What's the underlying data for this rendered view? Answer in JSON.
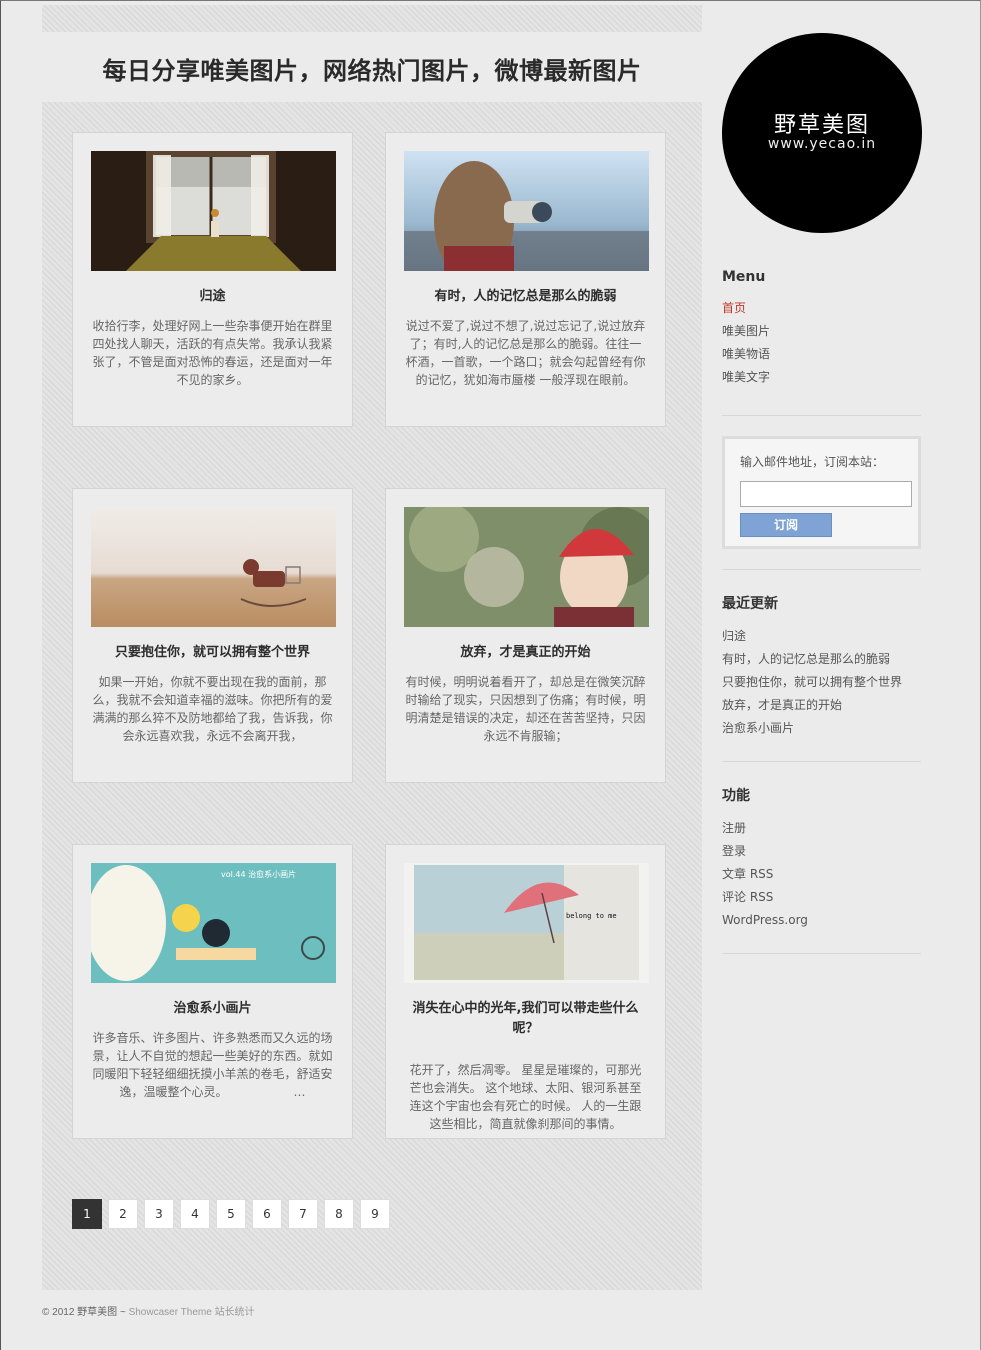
{
  "header": {
    "site_title": "每日分享唯美图片，网络热门图片，微博最新图片"
  },
  "logo": {
    "name": "野草美图",
    "url": "www.yecao.in"
  },
  "posts": [
    {
      "title": "归途",
      "excerpt": "收拾行李，处理好网上一些杂事便开始在群里四处找人聊天，活跃的有点失常。我承认我紧张了，不管是面对恐怖的春运，还是面对一年不见的家乡。"
    },
    {
      "title": "有时，人的记忆总是那么的脆弱",
      "excerpt": "说过不爱了,说过不想了,说过忘记了,说过放弃了；有时,人的记忆总是那么的脆弱。往往一杯酒，一首歌，一个路口；就会勾起曾经有你的记忆，犹如海市蜃楼 一般浮现在眼前。"
    },
    {
      "title": "只要抱住你，就可以拥有整个世界",
      "excerpt": "如果一开始，你就不要出现在我的面前，那么，我就不会知道幸福的滋味。你把所有的爱满满的那么猝不及防地都给了我，告诉我，你会永远喜欢我，永远不会离开我，"
    },
    {
      "title": "放弃，才是真正的开始",
      "excerpt": "有时候，明明说着看开了，却总是在微笑沉醉时输给了现实，只因想到了伤痛；有时候，明明清楚是错误的决定，却还在苦苦坚持，只因永远不肯服输；"
    },
    {
      "title": "治愈系小画片",
      "excerpt": "许多音乐、许多图片、许多熟悉而又久远的场景，让人不自觉的想起一些美好的东西。就如同暖阳下轻轻细细抚摸小羊羔的卷毛，舒适安逸，温暖整个心灵。　　　　　　…"
    },
    {
      "title": "消失在心中的光年,我们可以带走些什么呢？",
      "excerpt": "花开了，然后凋零。 星星是璀璨的，可那光芒也会消失。 这个地球、太阳、银河系甚至连这个宇宙也会有死亡的时候。 人的一生跟这些相比，简直就像刹那间的事情。"
    }
  ],
  "pagination": [
    "1",
    "2",
    "3",
    "4",
    "5",
    "6",
    "7",
    "8",
    "9"
  ],
  "pagination_current": "1",
  "sidebar": {
    "menu": {
      "title": "Menu",
      "items": [
        "首页",
        "唯美图片",
        "唯美物语",
        "唯美文字"
      ]
    },
    "subscribe": {
      "label": "输入邮件地址，订阅本站：",
      "email_value": "",
      "button": "订阅"
    },
    "recent": {
      "title": "最近更新",
      "items": [
        "归途",
        "有时，人的记忆总是那么的脆弱",
        "只要抱住你，就可以拥有整个世界",
        "放弃，才是真正的开始",
        "治愈系小画片"
      ]
    },
    "meta": {
      "title": "功能",
      "items": [
        "注册",
        "登录",
        "文章 RSS",
        "评论 RSS",
        "WordPress.org"
      ]
    }
  },
  "footer": {
    "copyright": "© 2012 野草美图 ~",
    "theme": "Showcaser Theme",
    "stats": "站长统计"
  },
  "colors": {
    "accent_link": "#c0392b",
    "subscribe_button": "#7fa3d4",
    "logo_bg": "#000000"
  }
}
